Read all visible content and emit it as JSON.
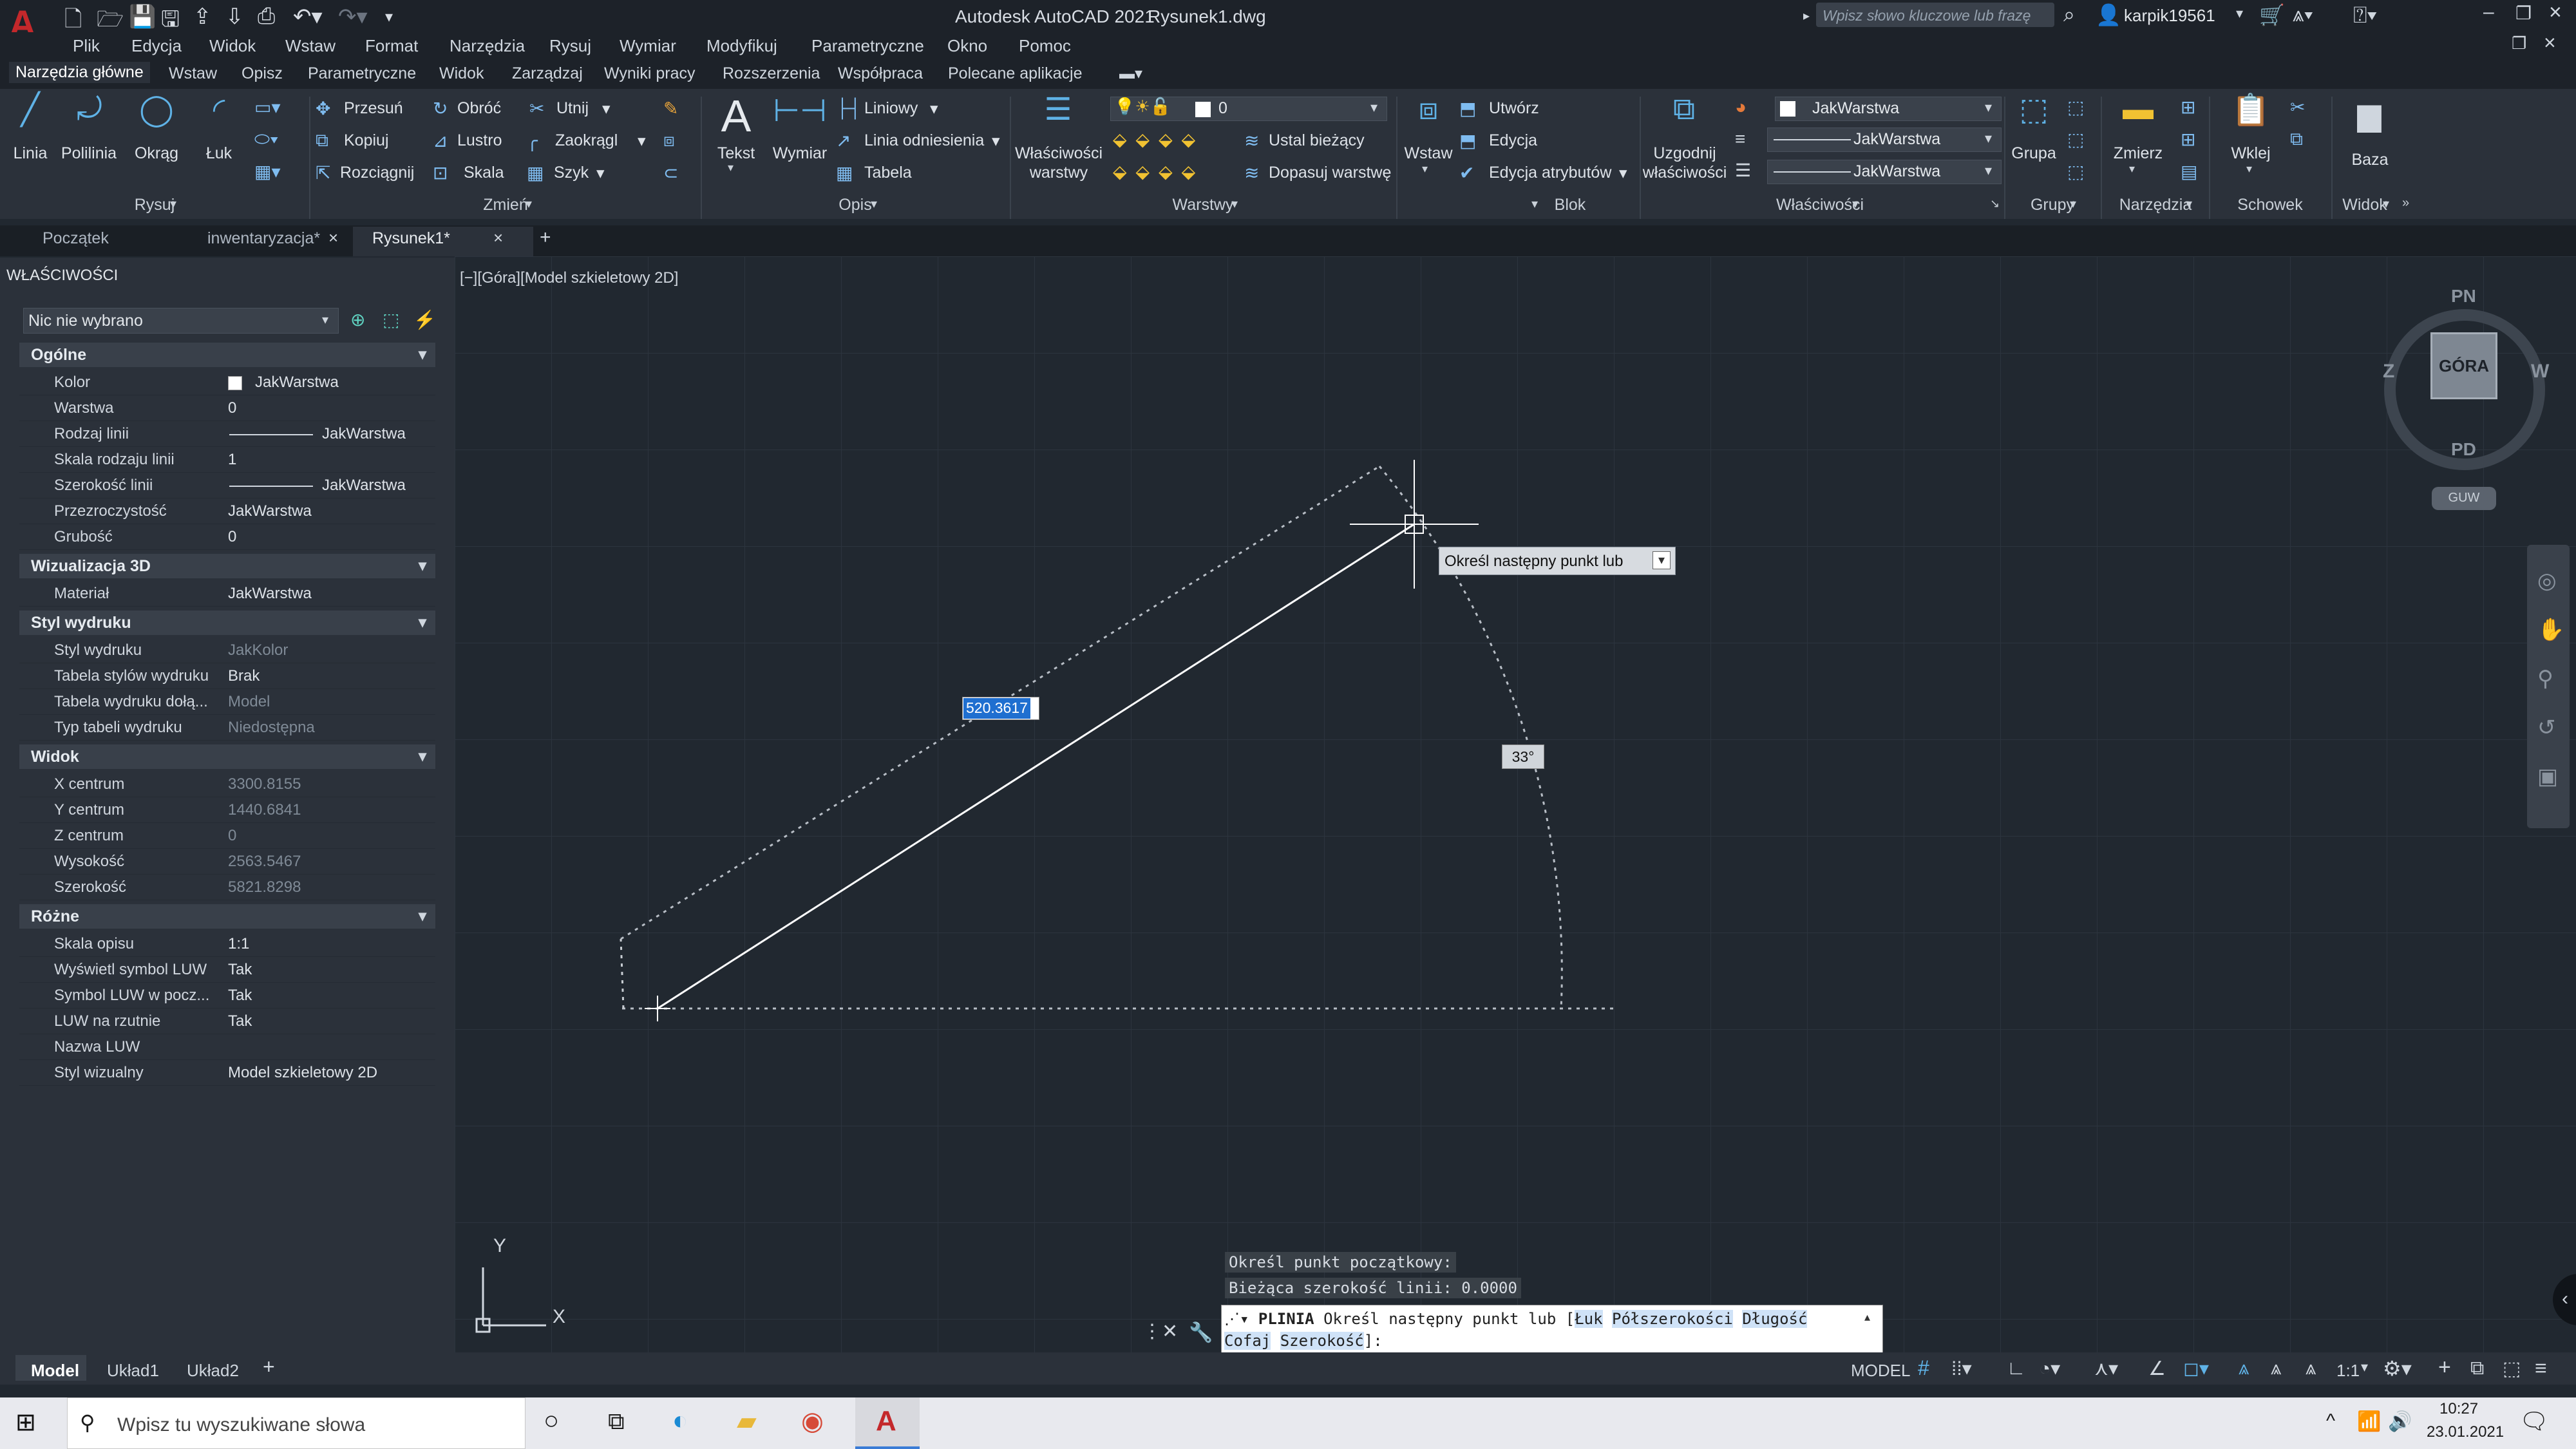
{
  "titlebar": {
    "app_title": "Autodesk AutoCAD 2021",
    "file_title": "Rysunek1.dwg",
    "search_placeholder": "Wpisz słowo kluczowe lub frazę",
    "user": "karpik19561"
  },
  "menubar": [
    "Plik",
    "Edycja",
    "Widok",
    "Wstaw",
    "Format",
    "Narzędzia",
    "Rysuj",
    "Wymiar",
    "Modyfikuj",
    "Parametryczne",
    "Okno",
    "Pomoc"
  ],
  "ribbon_tabs": [
    "Narzędzia główne",
    "Wstaw",
    "Opisz",
    "Parametryczne",
    "Widok",
    "Zarządzaj",
    "Wyniki pracy",
    "Rozszerzenia",
    "Współpraca",
    "Polecane aplikacje"
  ],
  "ribbon": {
    "draw": {
      "linia": "Linia",
      "polilinia": "Polilinia",
      "okrag": "Okrąg",
      "luk": "Łuk",
      "group": "Rysuj"
    },
    "modify": {
      "przesun": "Przesuń",
      "obroc": "Obróć",
      "utnij": "Utnij",
      "kopiuj": "Kopiuj",
      "lustro": "Lustro",
      "zaokraglij": "Zaokrągl",
      "rozciagnij": "Rozciągnij",
      "skala": "Skala",
      "szyk": "Szyk",
      "group": "Zmień"
    },
    "annotation": {
      "tekst": "Tekst",
      "wymiar": "Wymiar",
      "liniowy": "Liniowy",
      "linia_odniesienia": "Linia odniesienia",
      "tabela": "Tabela",
      "group": "Opis"
    },
    "layers": {
      "wlasciwosci_warstwy_1": "Właściwości",
      "wlasciwosci_warstwy_2": "warstwy",
      "layer_value": "0",
      "ustal_biezacy": "Ustal bieżący",
      "dopasuj_warstwe": "Dopasuj warstwę",
      "group": "Warstwy"
    },
    "block": {
      "wstaw": "Wstaw",
      "utworz": "Utwórz",
      "edycja": "Edycja",
      "edycja_atrybutow": "Edycja atrybutów",
      "group": "Blok"
    },
    "properties": {
      "uzgodnij_1": "Uzgodnij",
      "uzgodnij_2": "właściwości",
      "color_value": "JakWarstwa",
      "linetype_value": "JakWarstwa",
      "lineweight_value": "JakWarstwa",
      "group": "Właściwości"
    },
    "groups": {
      "grupa": "Grupa",
      "group": "Grupy"
    },
    "utilities": {
      "zmierz": "Zmierz",
      "group": "Narzędzia"
    },
    "clipboard": {
      "wklej": "Wklej",
      "group": "Schowek"
    },
    "view": {
      "baza": "Baza",
      "group": "Widok"
    }
  },
  "doc_tabs": [
    "Początek",
    "inwentaryzacja*",
    "Rysunek1*"
  ],
  "palette": {
    "title": "WŁAŚCIWOŚCI",
    "selection": "Nic nie wybrano",
    "sections": [
      {
        "name": "Ogólne",
        "rows": [
          {
            "label": "Kolor",
            "value": "JakWarstwa",
            "kind": "color"
          },
          {
            "label": "Warstwa",
            "value": "0"
          },
          {
            "label": "Rodzaj linii",
            "value": "JakWarstwa",
            "kind": "line"
          },
          {
            "label": "Skala rodzaju linii",
            "value": "1"
          },
          {
            "label": "Szerokość linii",
            "value": "JakWarstwa",
            "kind": "line"
          },
          {
            "label": "Przezroczystość",
            "value": "JakWarstwa"
          },
          {
            "label": "Grubość",
            "value": "0"
          }
        ]
      },
      {
        "name": "Wizualizacja 3D",
        "rows": [
          {
            "label": "Materiał",
            "value": "JakWarstwa"
          }
        ]
      },
      {
        "name": "Styl wydruku",
        "rows": [
          {
            "label": "Styl wydruku",
            "value": "JakKolor",
            "dim": true
          },
          {
            "label": "Tabela stylów wydruku",
            "value": "Brak"
          },
          {
            "label": "Tabela wydruku dołą...",
            "value": "Model",
            "dim": true
          },
          {
            "label": "Typ tabeli wydruku",
            "value": "Niedostępna",
            "dim": true
          }
        ]
      },
      {
        "name": "Widok",
        "rows": [
          {
            "label": "X centrum",
            "value": "3300.8155",
            "dim": true
          },
          {
            "label": "Y centrum",
            "value": "1440.6841",
            "dim": true
          },
          {
            "label": "Z centrum",
            "value": "0",
            "dim": true
          },
          {
            "label": "Wysokość",
            "value": "2563.5467",
            "dim": true
          },
          {
            "label": "Szerokość",
            "value": "5821.8298",
            "dim": true
          }
        ]
      },
      {
        "name": "Różne",
        "rows": [
          {
            "label": "Skala opisu",
            "value": "1:1"
          },
          {
            "label": "Wyświetl symbol LUW",
            "value": "Tak"
          },
          {
            "label": "Symbol LUW w pocz...",
            "value": "Tak"
          },
          {
            "label": "LUW na rzutnie",
            "value": "Tak"
          },
          {
            "label": "Nazwa LUW",
            "value": ""
          },
          {
            "label": "Styl wizualny",
            "value": "Model szkieletowy 2D"
          }
        ]
      }
    ]
  },
  "canvas": {
    "viewport_label": "[−][Góra][Model szkieletowy 2D]",
    "tooltip": "Określ następny punkt lub",
    "length_input": "520.3617",
    "angle_input": "33°",
    "viewcube": {
      "n": "PN",
      "s": "PD",
      "w": "Z",
      "e": "W",
      "top": "GÓRA",
      "wcs": "GUW"
    },
    "ucs": {
      "x": "X",
      "y": "Y"
    }
  },
  "command": {
    "history": [
      "Określ punkt początkowy:",
      "Bieżąca szerokość linii: 0.0000"
    ],
    "prompt_cmd": "PLINIA",
    "prompt_text": "Określ następny punkt lub [",
    "options": [
      "Łuk",
      "Półszerokości",
      "Długość",
      "Cofaj",
      "Szerokość"
    ],
    "prompt_end": "]:"
  },
  "layout_tabs": [
    "Model",
    "Układ1",
    "Układ2"
  ],
  "statusbar": {
    "model": "MODEL",
    "scale": "1:1"
  },
  "taskbar": {
    "search": "Wpisz tu wyszukiwane słowa",
    "time": "10:27",
    "date": "23.01.2021"
  }
}
